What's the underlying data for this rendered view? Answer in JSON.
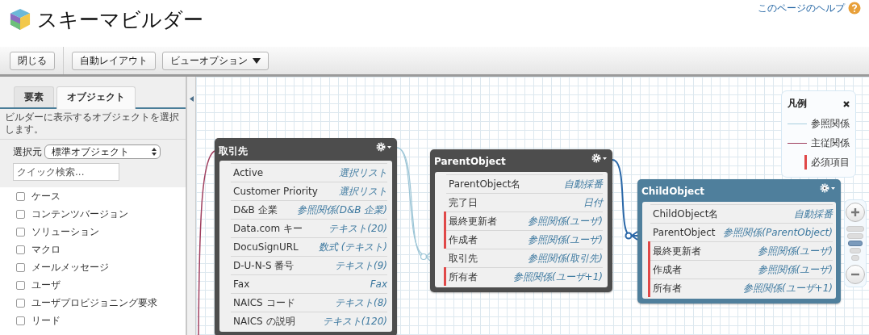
{
  "header": {
    "title": "スキーマビルダー",
    "help_link": "このページのヘルプ"
  },
  "toolbar": {
    "buttons": [
      {
        "label": "閉じる",
        "kind": "plain"
      },
      {
        "label": "自動レイアウト",
        "kind": "plain"
      },
      {
        "label": "ビューオプション",
        "kind": "dropdown"
      }
    ]
  },
  "sidebar": {
    "tabs": [
      {
        "label": "要素",
        "selected": false
      },
      {
        "label": "オブジェクト",
        "selected": true
      }
    ],
    "description": "ビルダーに表示するオブジェクトを選択します。",
    "source_label": "選択元",
    "source_value": "標準オブジェクト",
    "search": {
      "placeholder": "クイック検索..."
    },
    "items": [
      {
        "label": "ケース",
        "checked": false
      },
      {
        "label": "コンテンツバージョン",
        "checked": false
      },
      {
        "label": "ソリューション",
        "checked": false
      },
      {
        "label": "マクロ",
        "checked": false
      },
      {
        "label": "メールメッセージ",
        "checked": false
      },
      {
        "label": "ユーザ",
        "checked": false
      },
      {
        "label": "ユーザプロビジョニング要求",
        "checked": false
      },
      {
        "label": "リード",
        "checked": false
      }
    ]
  },
  "canvas": {
    "objects": [
      {
        "name": "取引先",
        "selected": false,
        "fields": [
          {
            "name": "Active",
            "type": "選択リスト",
            "required": false
          },
          {
            "name": "Customer Priority",
            "type": "選択リスト",
            "required": false
          },
          {
            "name": "D&B 企業",
            "type": "参照関係(D&B 企業)",
            "required": false
          },
          {
            "name": "Data.com キー",
            "type": "テキスト(20)",
            "required": false
          },
          {
            "name": "DocuSignURL",
            "type": "数式 (テキスト)",
            "required": false
          },
          {
            "name": "D-U-N-S 番号",
            "type": "テキスト(9)",
            "required": false
          },
          {
            "name": "Fax",
            "type": "Fax",
            "required": false
          },
          {
            "name": "NAICS コード",
            "type": "テキスト(8)",
            "required": false
          },
          {
            "name": "NAICS の説明",
            "type": "テキスト(120)",
            "required": false
          }
        ]
      },
      {
        "name": "ParentObject",
        "selected": false,
        "fields": [
          {
            "name": "ParentObject名",
            "type": "自動採番",
            "required": false
          },
          {
            "name": "完了日",
            "type": "日付",
            "required": false
          },
          {
            "name": "最終更新者",
            "type": "参照関係(ユーザ)",
            "required": true
          },
          {
            "name": "作成者",
            "type": "参照関係(ユーザ)",
            "required": true
          },
          {
            "name": "取引先",
            "type": "参照関係(取引先)",
            "required": false
          },
          {
            "name": "所有者",
            "type": "参照関係(ユーザ+1)",
            "required": true
          }
        ]
      },
      {
        "name": "ChildObject",
        "selected": true,
        "fields": [
          {
            "name": "ChildObject名",
            "type": "自動採番",
            "required": false
          },
          {
            "name": "ParentObject",
            "type": "参照関係(ParentObject)",
            "required": false
          },
          {
            "name": "最終更新者",
            "type": "参照関係(ユーザ)",
            "required": true
          },
          {
            "name": "作成者",
            "type": "参照関係(ユーザ)",
            "required": true
          },
          {
            "name": "所有者",
            "type": "参照関係(ユーザ+1)",
            "required": true
          }
        ]
      }
    ],
    "legend": {
      "title": "凡例",
      "items": [
        {
          "label": "参照関係",
          "kind": "lookup"
        },
        {
          "label": "主従関係",
          "kind": "master"
        },
        {
          "label": "必須項目",
          "kind": "required"
        }
      ]
    },
    "zoom": {
      "level": 0.5
    }
  }
}
